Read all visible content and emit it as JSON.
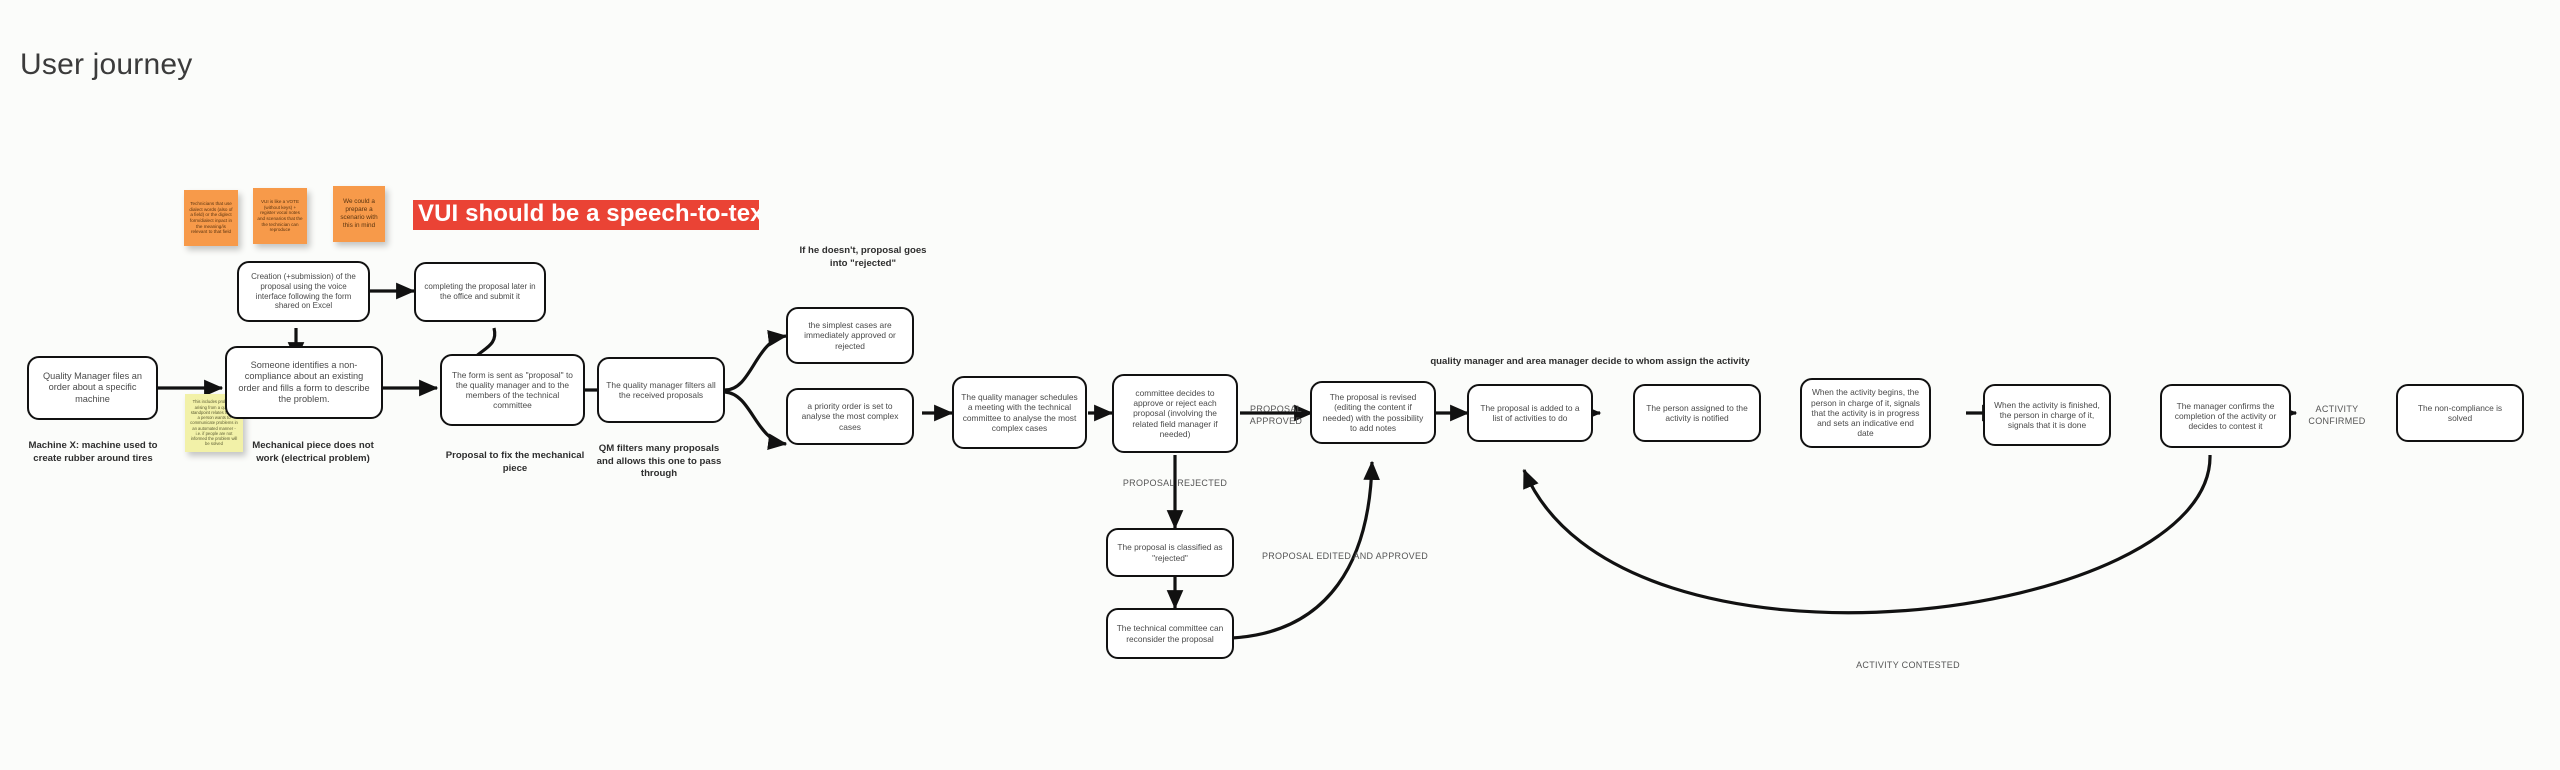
{
  "page": {
    "title": "User journey",
    "background_color": "#fbfcfa",
    "accent_red": "#ea4335",
    "sticky_orange": "#f79a4a",
    "sticky_yellow": "#f2f1a8"
  },
  "banner": {
    "text": "VUI should be a speech-to-text convert"
  },
  "sticky_notes": [
    {
      "id": "note-technicians",
      "color": "orange",
      "text": "Technicians that use dialect words (also of a field) or the diglect form/dialect inpact in the meaning/is relevant to that field"
    },
    {
      "id": "note-vui-vs-vote",
      "color": "orange",
      "text": "VUI is like a VOTE (without keys) + register vocal notes and scenarios that the the technician can reproduce"
    },
    {
      "id": "note-scenario",
      "color": "orange",
      "text": "We could a prepare a scenario with this in mind"
    },
    {
      "id": "note-yellow-problem",
      "color": "yellow",
      "text": "This includes problems arising from a quality standpoint relates to how a person wants to communicate problems in an automated manner - i.e. if people are not informed the problem will be solved"
    }
  ],
  "nodes": [
    {
      "id": "n-qm-order",
      "text": "Quality Manager files an order about a specific machine"
    },
    {
      "id": "n-creation-proposal",
      "text": "Creation (+submission) of the proposal using the voice interface following the form shared on Excel"
    },
    {
      "id": "n-completing-proposal",
      "text": "completing the proposal later in the office and submit it"
    },
    {
      "id": "n-identify-noncompliance",
      "text": "Someone identifies a non-compliance about an existing order and fills a form to describe the problem."
    },
    {
      "id": "n-form-sent",
      "text": "The form is sent as \"proposal\" to the quality manager and to the members of the technical committee"
    },
    {
      "id": "n-qm-filters",
      "text": "The quality manager filters all the received proposals"
    },
    {
      "id": "n-simplest-cases",
      "text": "the simplest cases are immediately approved or rejected"
    },
    {
      "id": "n-priority-order",
      "text": "a priority order is set to analyse the most complex cases"
    },
    {
      "id": "n-qm-schedules",
      "text": "The quality manager schedules a meeting with the technical committee to analyse the most complex cases"
    },
    {
      "id": "n-committee-decides",
      "text": "committee decides to approve or reject each proposal (involving the related field manager if needed)"
    },
    {
      "id": "n-classified-rejected",
      "text": "The proposal is classified as \"rejected\""
    },
    {
      "id": "n-committee-reconsider",
      "text": "The technical committee can reconsider the proposal"
    },
    {
      "id": "n-proposal-revised",
      "text": "The proposal is revised (editing the content if needed) with the possibility to add notes"
    },
    {
      "id": "n-added-to-list",
      "text": "The proposal is added to a list of activities to do"
    },
    {
      "id": "n-person-notified",
      "text": "The person assigned to the activity is notified"
    },
    {
      "id": "n-activity-begins",
      "text": "When the activity begins, the person in charge of it, signals that the activity is in progress and sets an indicative end date"
    },
    {
      "id": "n-activity-finished",
      "text": "When the activity is finished, the person in charge of it, signals that it is done"
    },
    {
      "id": "n-manager-confirms",
      "text": "The manager confirms the completion of the activity or decides to contest it"
    },
    {
      "id": "n-noncompliance-solved",
      "text": "The non-compliance is solved"
    }
  ],
  "captions": [
    {
      "id": "cap-machine-x",
      "text": "Machine X: machine used to create rubber around tires"
    },
    {
      "id": "cap-mechanical-piece",
      "text": "Mechanical piece does not work (electrical problem)"
    },
    {
      "id": "cap-proposal-fix",
      "text": "Proposal to fix the mechanical piece"
    },
    {
      "id": "cap-qm-filters",
      "text": "QM filters many proposals and allows this one to pass through"
    },
    {
      "id": "cap-if-he-doesnt",
      "text": "If he doesn't, proposal goes into \"rejected\""
    },
    {
      "id": "cap-assign-activity",
      "text": "quality manager and  area manager decide to whom assign the activity"
    }
  ],
  "edge_labels": [
    {
      "id": "lbl-proposal-approved",
      "text": "PROPOSAL APPROVED"
    },
    {
      "id": "lbl-proposal-rejected",
      "text": "PROPOSAL REJECTED"
    },
    {
      "id": "lbl-proposal-edited-approved",
      "text": "PROPOSAL EDITED AND APPROVED"
    },
    {
      "id": "lbl-activity-confirmed",
      "text": "ACTIVITY CONFIRMED"
    },
    {
      "id": "lbl-activity-contested",
      "text": "ACTIVITY CONTESTED"
    }
  ]
}
